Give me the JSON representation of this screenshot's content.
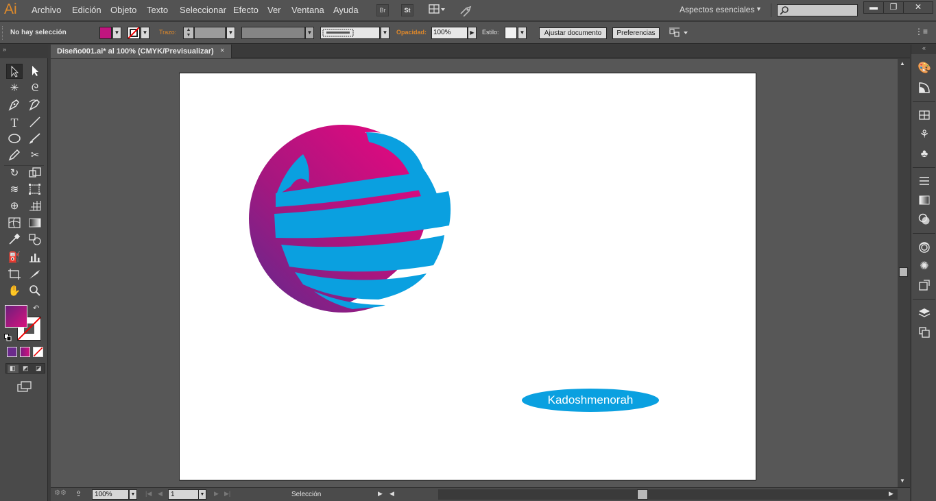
{
  "app": {
    "logo": "Ai"
  },
  "menu": [
    "Archivo",
    "Edición",
    "Objeto",
    "Texto",
    "Seleccionar",
    "Efecto",
    "Ver",
    "Ventana",
    "Ayuda"
  ],
  "menubar_buttons": {
    "bridge": "Br",
    "stock": "St"
  },
  "workspace": {
    "label": "Aspectos esenciales"
  },
  "control": {
    "selection_status": "No hay selección",
    "stroke_label": "Trazo:",
    "opacity_label": "Opacidad:",
    "opacity_value": "100%",
    "style_label": "Estilo:",
    "fit_document": "Ajustar documento",
    "preferences": "Preferencias"
  },
  "document": {
    "tab_title": "Diseño001.ai* al 100% (CMYK/Previsualizar)",
    "close_glyph": "×"
  },
  "artwork": {
    "label_text": "Kadoshmenorah",
    "colors": {
      "magenta": "#e0087f",
      "purple": "#6b2a8c",
      "cyan": "#0aa0e0"
    }
  },
  "status": {
    "zoom": "100%",
    "artboard_number": "1",
    "current_tool": "Selección"
  },
  "colors": {
    "fill": "#c0157f",
    "accent_orange": "#e0892a",
    "ui_bg": "#535353"
  }
}
